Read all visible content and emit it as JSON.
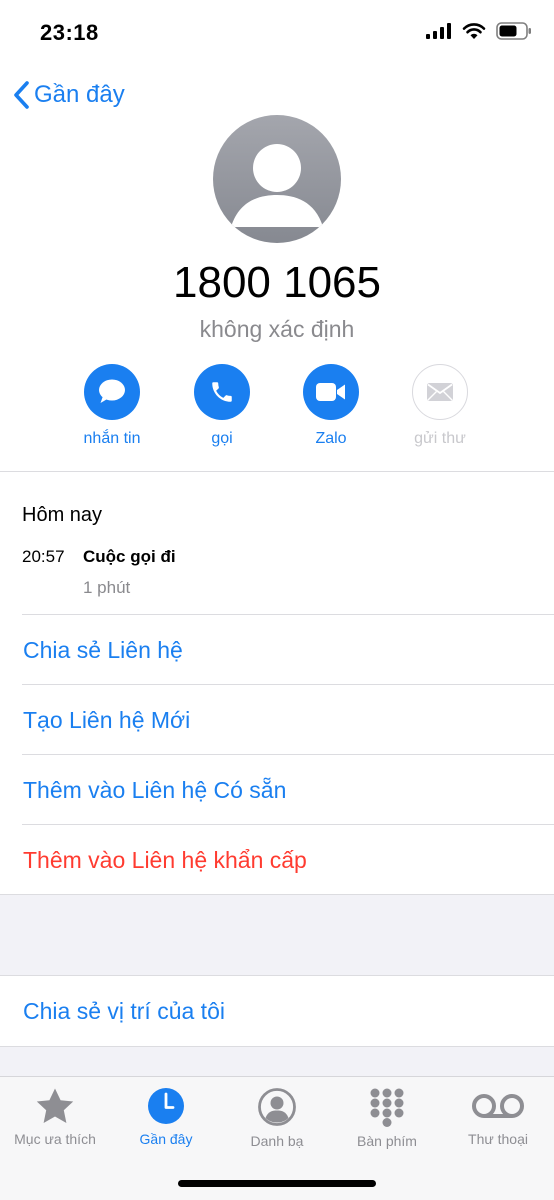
{
  "status": {
    "time": "23:18"
  },
  "nav": {
    "back_label": "Gần đây"
  },
  "contact": {
    "number": "1800 1065",
    "subtitle": "không xác định"
  },
  "actions": [
    {
      "label": "nhắn tin",
      "icon": "message-icon",
      "enabled": true
    },
    {
      "label": "gọi",
      "icon": "phone-icon",
      "enabled": true
    },
    {
      "label": "Zalo",
      "icon": "video-icon",
      "enabled": true
    },
    {
      "label": "gửi thư",
      "icon": "mail-icon",
      "enabled": false
    }
  ],
  "recent": {
    "date": "Hôm nay",
    "call_time": "20:57",
    "call_type": "Cuộc gọi đi",
    "duration": "1 phút"
  },
  "options": [
    {
      "label": "Chia sẻ Liên hệ"
    },
    {
      "label": "Tạo Liên hệ Mới"
    },
    {
      "label": "Thêm vào Liên hệ Có sẵn"
    },
    {
      "label": "Thêm vào Liên hệ khẩn cấp"
    }
  ],
  "location": {
    "label": "Chia sẻ vị trí của tôi"
  },
  "tabs": [
    {
      "label": "Mục ưa thích",
      "icon": "star-icon"
    },
    {
      "label": "Gần đây",
      "icon": "clock-icon",
      "active": true
    },
    {
      "label": "Danh bạ",
      "icon": "contacts-icon"
    },
    {
      "label": "Bàn phím",
      "icon": "keypad-icon"
    },
    {
      "label": "Thư thoại",
      "icon": "voicemail-icon"
    }
  ],
  "colors": {
    "accent": "#1a7ff0",
    "destructive": "#ff3b30",
    "secondary_text": "#8a8a8e",
    "grouped_background": "#f2f2f7"
  }
}
